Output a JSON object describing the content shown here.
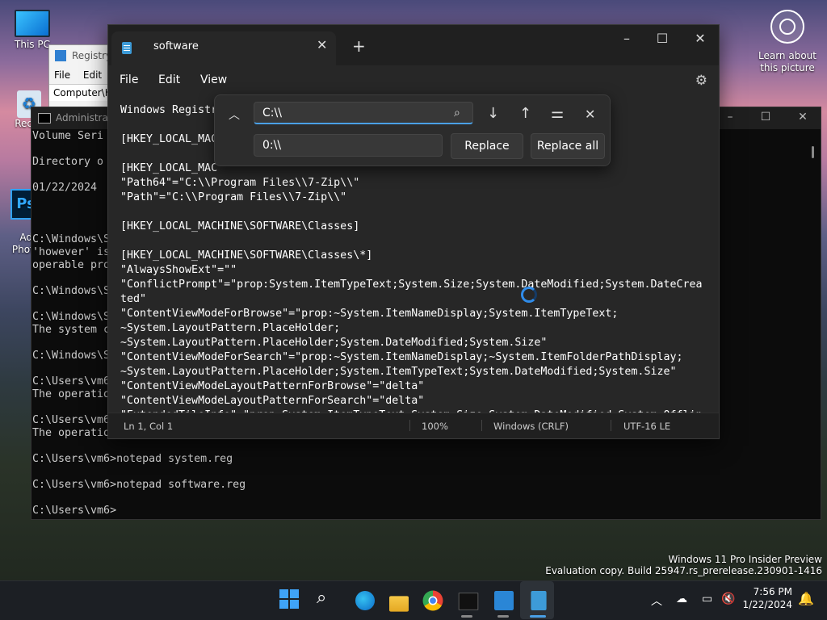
{
  "desktop": {
    "icons": [
      {
        "label": "This PC"
      },
      {
        "label": "Recyc"
      },
      {
        "label": "Ado\nPhoto"
      }
    ],
    "learn_label": "Learn about this picture"
  },
  "regedit": {
    "title": "Registry",
    "menu": "File  Edit",
    "address": "Computer\\H"
  },
  "cmd": {
    "title": "Administrato",
    "lines": [
      "Volume Seri",
      "",
      "Directory o",
      "",
      "01/22/2024",
      "",
      "",
      "",
      "C:\\Windows\\S",
      "'however' is",
      "operable pro",
      "",
      "C:\\Windows\\S",
      "",
      "C:\\Windows\\S",
      "The system c",
      "",
      "C:\\Windows\\S",
      "",
      "C:\\Users\\vm6",
      "The operatio",
      "",
      "C:\\Users\\vm6",
      "The operatio",
      "",
      "C:\\Users\\vm6>notepad system.reg",
      "",
      "C:\\Users\\vm6>notepad software.reg",
      "",
      "C:\\Users\\vm6>"
    ]
  },
  "notepad": {
    "tab_title": "software",
    "menu": {
      "file": "File",
      "edit": "Edit",
      "view": "View"
    },
    "lines": [
      "Windows Registr",
      "",
      "[HKEY_LOCAL_MAC",
      "",
      "[HKEY_LOCAL_MAC",
      "\"Path64\"=\"C:\\\\Program Files\\\\7-Zip\\\\\"",
      "\"Path\"=\"C:\\\\Program Files\\\\7-Zip\\\\\"",
      "",
      "[HKEY_LOCAL_MACHINE\\SOFTWARE\\Classes]",
      "",
      "[HKEY_LOCAL_MACHINE\\SOFTWARE\\Classes\\*]",
      "\"AlwaysShowExt\"=\"\"",
      "\"ConflictPrompt\"=\"prop:System.ItemTypeText;System.Size;System.DateModified;System.DateCrea",
      "ted\"",
      "\"ContentViewModeForBrowse\"=\"prop:~System.ItemNameDisplay;System.ItemTypeText;",
      "~System.LayoutPattern.PlaceHolder;",
      "~System.LayoutPattern.PlaceHolder;System.DateModified;System.Size\"",
      "\"ContentViewModeForSearch\"=\"prop:~System.ItemNameDisplay;~System.ItemFolderPathDisplay;",
      "~System.LayoutPattern.PlaceHolder;System.ItemTypeText;System.DateModified;System.Size\"",
      "\"ContentViewModeLayoutPatternForBrowse\"=\"delta\"",
      "\"ContentViewModeLayoutPatternForSearch\"=\"delta\"",
      "\"ExtendedTileInfo\"=\"prop:System.ItemTypeText;System.Size;System.DateModified;System.Offlin"
    ],
    "status": {
      "position": "Ln 1, Col 1",
      "zoom": "100%",
      "line_ending": "Windows (CRLF)",
      "encoding": "UTF-16 LE"
    }
  },
  "find_replace": {
    "find_value": "C:\\\\",
    "replace_value": "0:\\\\",
    "replace_label": "Replace",
    "replace_all_label": "Replace all"
  },
  "watermark": {
    "line1": "Windows 11 Pro Insider Preview",
    "line2": "Evaluation copy. Build 25947.rs_prerelease.230901-1416"
  },
  "clock": {
    "time": "7:56 PM",
    "date": "1/22/2024"
  },
  "colors": {
    "accent": "#4aa0e6",
    "notepad_bg": "#272727",
    "cmd_bg": "#0c0c0c"
  }
}
